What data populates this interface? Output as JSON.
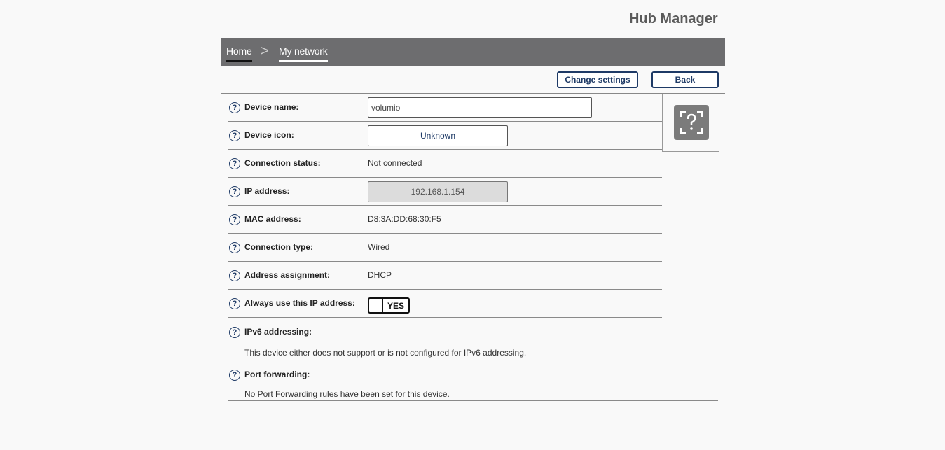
{
  "app": {
    "title": "Hub Manager"
  },
  "breadcrumb": {
    "home": "Home",
    "separator": ">",
    "current": "My network"
  },
  "toolbar": {
    "change_settings": "Change settings",
    "back": "Back"
  },
  "help_glyph": "?",
  "fields": {
    "device_name": {
      "label": "Device name:",
      "value": "volumio"
    },
    "device_icon": {
      "label": "Device icon:",
      "value": "Unknown"
    },
    "connection_status": {
      "label": "Connection status:",
      "value": "Not connected"
    },
    "ip_address": {
      "label": "IP address:",
      "value": "192.168.1.154"
    },
    "mac_address": {
      "label": "MAC address:",
      "value": "D8:3A:DD:68:30:F5"
    },
    "connection_type": {
      "label": "Connection type:",
      "value": "Wired"
    },
    "address_assignment": {
      "label": "Address assignment:",
      "value": "DHCP"
    },
    "always_use_ip": {
      "label": "Always use this IP address:",
      "value": "YES"
    }
  },
  "ipv6": {
    "label": "IPv6 addressing:",
    "text": "This device either does not support or is not configured for IPv6 addressing."
  },
  "port_forwarding": {
    "label": "Port forwarding:",
    "text": "No Port Forwarding rules have been set for this device."
  },
  "device_image": {
    "icon": "unknown-device-icon"
  },
  "colors": {
    "nav": "#6d6d6f",
    "accent": "#1e3a66",
    "background": "#f9f9f9"
  }
}
